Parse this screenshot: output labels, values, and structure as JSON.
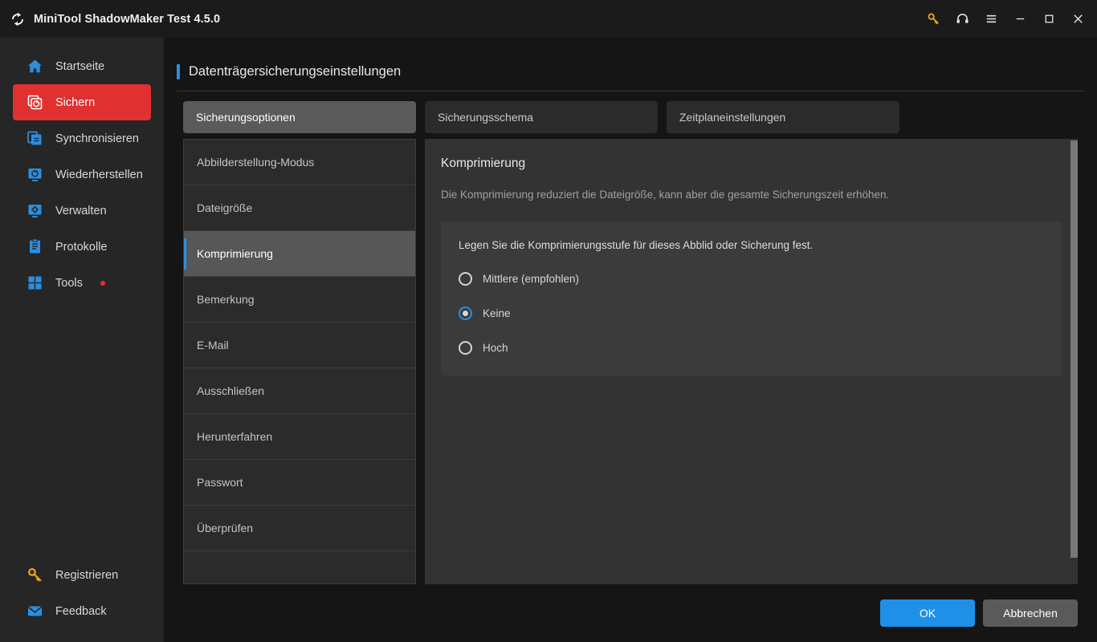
{
  "window": {
    "title": "MiniTool ShadowMaker Test 4.5.0",
    "logo_icon": "refresh-circle-icon",
    "controls": [
      {
        "name": "key-icon",
        "label": ""
      },
      {
        "name": "headset-icon",
        "label": ""
      },
      {
        "name": "hamburger-menu-icon",
        "label": ""
      },
      {
        "name": "minimize-icon",
        "label": ""
      },
      {
        "name": "maximize-icon",
        "label": ""
      },
      {
        "name": "close-icon",
        "label": ""
      }
    ]
  },
  "sidebar": {
    "items": [
      {
        "label": "Startseite",
        "icon": "home-icon",
        "active": false,
        "badge": false
      },
      {
        "label": "Sichern",
        "icon": "backup-icon",
        "active": true,
        "badge": false
      },
      {
        "label": "Synchronisieren",
        "icon": "sync-icon",
        "active": false,
        "badge": false
      },
      {
        "label": "Wiederherstellen",
        "icon": "restore-icon",
        "active": false,
        "badge": false
      },
      {
        "label": "Verwalten",
        "icon": "manage-icon",
        "active": false,
        "badge": false
      },
      {
        "label": "Protokolle",
        "icon": "logs-icon",
        "active": false,
        "badge": false
      },
      {
        "label": "Tools",
        "icon": "tools-icon",
        "active": false,
        "badge": true
      }
    ],
    "bottom_items": [
      {
        "label": "Registrieren",
        "icon": "key-icon"
      },
      {
        "label": "Feedback",
        "icon": "mail-icon"
      }
    ]
  },
  "page": {
    "title": "Datenträgersicherungseinstellungen"
  },
  "tabs": [
    {
      "label": "Sicherungsoptionen",
      "active": true
    },
    {
      "label": "Sicherungsschema",
      "active": false
    },
    {
      "label": "Zeitplaneinstellungen",
      "active": false
    }
  ],
  "option_list": [
    {
      "label": "Abbilderstellung-Modus",
      "active": false
    },
    {
      "label": "Dateigröße",
      "active": false
    },
    {
      "label": "Komprimierung",
      "active": true
    },
    {
      "label": "Bemerkung",
      "active": false
    },
    {
      "label": "E-Mail",
      "active": false
    },
    {
      "label": "Ausschließen",
      "active": false
    },
    {
      "label": "Herunterfahren",
      "active": false
    },
    {
      "label": "Passwort",
      "active": false
    },
    {
      "label": "Überprüfen",
      "active": false
    }
  ],
  "content": {
    "title": "Komprimierung",
    "description": "Die Komprimierung reduziert die Dateigröße, kann aber die gesamte Sicherungszeit erhöhen.",
    "card_prompt": "Legen Sie die Komprimierungsstufe für dieses Abblid oder Sicherung fest.",
    "radios": [
      {
        "label": "Mittlere (empfohlen)",
        "checked": false
      },
      {
        "label": "Keine",
        "checked": true
      },
      {
        "label": "Hoch",
        "checked": false
      }
    ]
  },
  "footer": {
    "ok_label": "OK",
    "cancel_label": "Abbrechen"
  },
  "colors": {
    "accent_blue": "#2a8fe0",
    "primary_button": "#1f90e8",
    "active_red": "#e03030",
    "icon_blue": "#2a8fe0",
    "key_gold": "#e8a51c"
  }
}
